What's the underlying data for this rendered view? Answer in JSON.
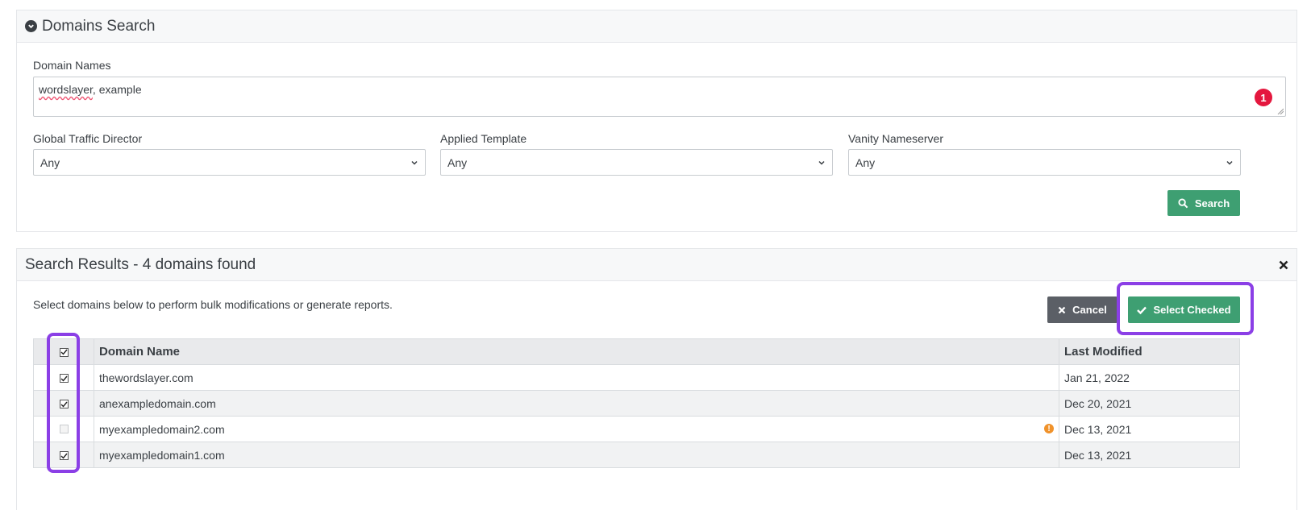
{
  "search_panel": {
    "title": "Domains Search",
    "domain_names_label": "Domain Names",
    "domain_names_word1": "wordslayer",
    "domain_names_rest": ", example",
    "error_count": "1",
    "gtd_label": "Global Traffic Director",
    "gtd_value": "Any",
    "template_label": "Applied Template",
    "template_value": "Any",
    "vanity_label": "Vanity Nameserver",
    "vanity_value": "Any",
    "search_button": "Search"
  },
  "results_panel": {
    "title": "Search Results - 4 domains found",
    "hint": "Select domains below to perform bulk modifications or generate reports.",
    "cancel_button": "Cancel",
    "select_checked_button": "Select Checked",
    "columns": {
      "domain": "Domain Name",
      "modified": "Last Modified"
    },
    "rows": [
      {
        "domain": "thewordslayer.com",
        "modified": "Jan 21, 2022",
        "checked": true,
        "warning": false
      },
      {
        "domain": "anexampledomain.com",
        "modified": "Dec 20, 2021",
        "checked": true,
        "warning": false
      },
      {
        "domain": "myexampledomain2.com",
        "modified": "Dec 13, 2021",
        "checked": false,
        "warning": true
      },
      {
        "domain": "myexampledomain1.com",
        "modified": "Dec 13, 2021",
        "checked": true,
        "warning": false
      }
    ]
  },
  "colors": {
    "accent_green": "#3e9f72",
    "highlight_purple": "#8b3fe6",
    "error_red": "#e4173e",
    "warning_orange": "#f0922b"
  }
}
